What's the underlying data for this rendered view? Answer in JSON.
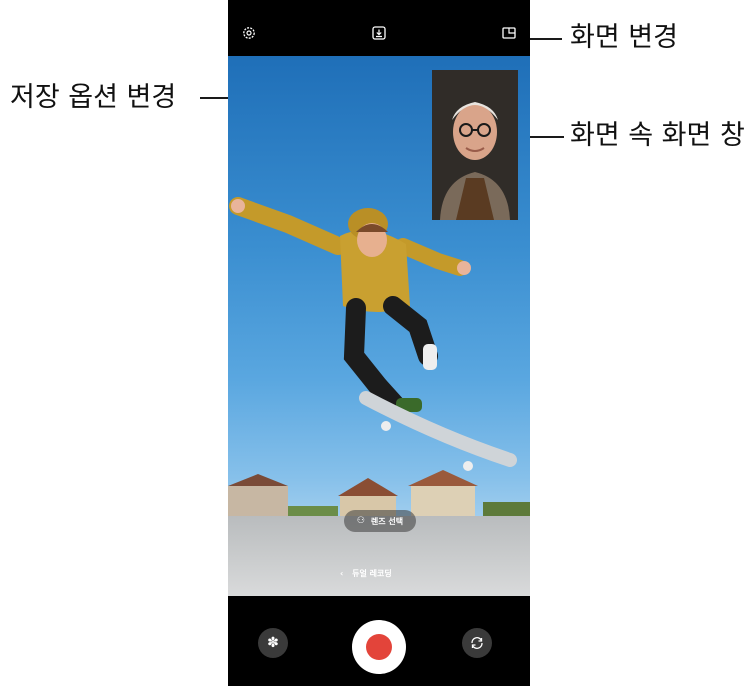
{
  "callouts": {
    "screen_change": "화면 변경",
    "save_options": "저장 옵션 변경",
    "pip_window": "화면 속 화면 창"
  },
  "camera": {
    "lens_select": "렌즈 선택",
    "dual_recording": "듀얼 레코딩"
  },
  "icons": {
    "settings": "gear-icon",
    "save_option": "download-box-icon",
    "screen_layout": "layout-icon",
    "effects": "flower-icon",
    "shutter": "record-icon",
    "switch_camera": "switch-camera-icon",
    "back": "chevron-left-icon",
    "lens": "lens-circles-icon"
  },
  "colors": {
    "record": "#e3443a",
    "sky": "#3a8ed0"
  }
}
